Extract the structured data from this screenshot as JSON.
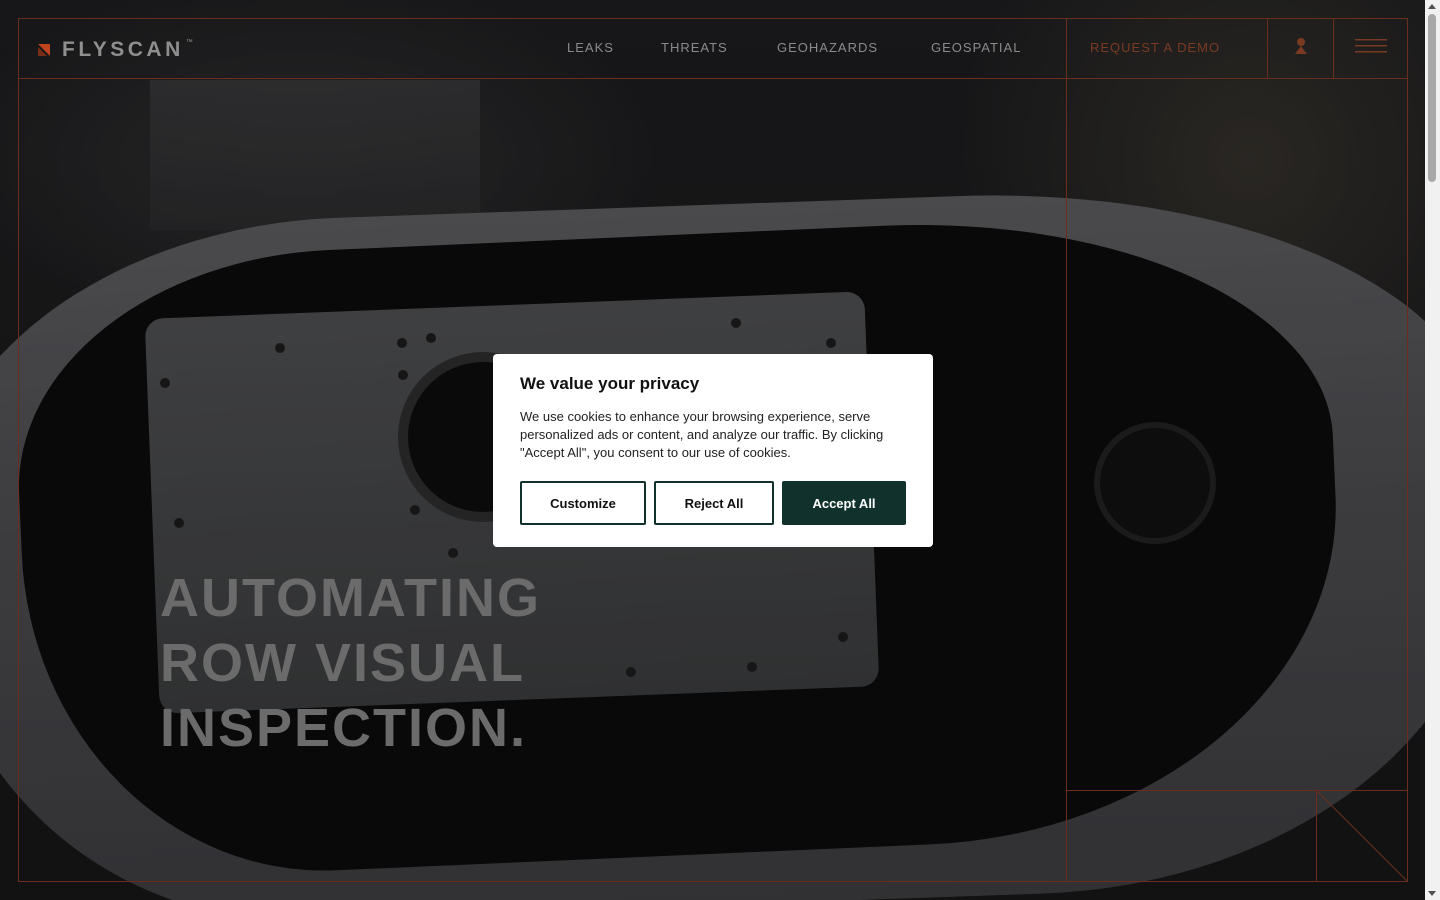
{
  "brand": {
    "name": "FLYSCAN",
    "tm": "™",
    "accent": "#d4502a"
  },
  "nav": {
    "items": [
      {
        "label": "LEAKS"
      },
      {
        "label": "THREATS"
      },
      {
        "label": "GEOHAZARDS"
      },
      {
        "label": "GEOSPATIAL"
      }
    ],
    "cta": "REQUEST A DEMO",
    "account_icon": "user-icon",
    "menu_icon": "hamburger-menu-icon"
  },
  "hero": {
    "lines": [
      "AUTOMATING",
      "ROW VISUAL",
      "INSPECTION."
    ]
  },
  "cookie": {
    "title": "We value your privacy",
    "body": "We use cookies to enhance your browsing experience, serve personalized ads or content, and analyze our traffic. By clicking \"Accept All\", you consent to our use of cookies.",
    "customize": "Customize",
    "reject": "Reject All",
    "accept": "Accept All",
    "accept_color": "#10312c"
  }
}
